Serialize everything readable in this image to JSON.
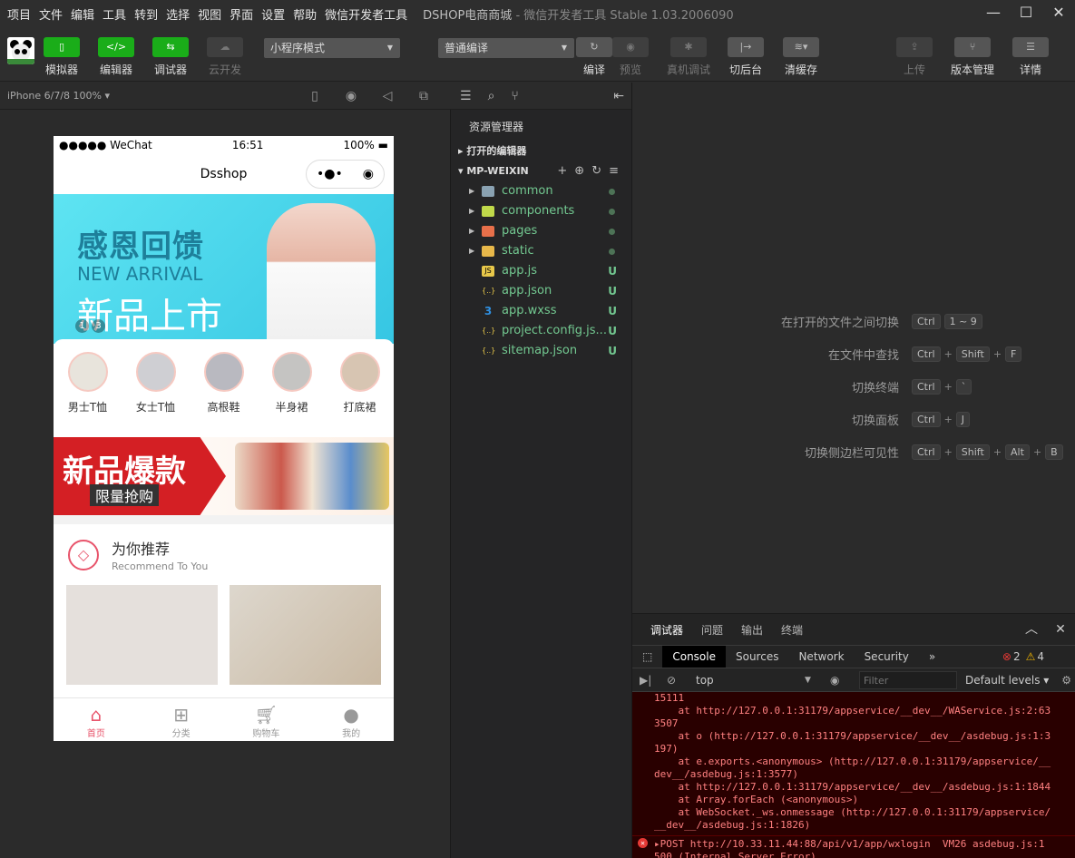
{
  "menu": [
    "项目",
    "文件",
    "编辑",
    "工具",
    "转到",
    "选择",
    "视图",
    "界面",
    "设置",
    "帮助",
    "微信开发者工具"
  ],
  "window": {
    "title": "DSHOP电商商城",
    "subtitle": "- 微信开发者工具 Stable 1.03.2006090"
  },
  "toolbar": {
    "simulator": "模拟器",
    "editor": "编辑器",
    "debugger": "调试器",
    "cloud": "云开发",
    "mode_select": "小程序模式",
    "compile_select": "普通编译",
    "compile": "编译",
    "preview": "预览",
    "remote_debug": "真机调试",
    "background": "切后台",
    "clear_cache": "清缓存",
    "upload": "上传",
    "version": "版本管理",
    "details": "详情"
  },
  "device": {
    "label": "iPhone 6/7/8 100% ▾"
  },
  "phone": {
    "carrier": "●●●●● WeChat",
    "time": "16:51",
    "battery": "100%",
    "nav_title": "Dsshop",
    "banner": {
      "line1": "感恩回馈",
      "line2": "NEW ARRIVAL",
      "line3": "新品上市",
      "page": "1",
      "total": "3"
    },
    "categories": [
      "男士T恤",
      "女士T恤",
      "高根鞋",
      "半身裙",
      "打底裙"
    ],
    "promo": {
      "title": "新品爆款",
      "subtitle": "限量抢购"
    },
    "recommend": {
      "title": "为你推荐",
      "subtitle": "Recommend To You"
    },
    "tabs": [
      "首页",
      "分类",
      "购物车",
      "我的"
    ]
  },
  "explorer": {
    "title": "资源管理器",
    "open_editors": "打开的编辑器",
    "project": "MP-WEIXIN",
    "items": [
      {
        "name": "common",
        "type": "folder",
        "color": "#8aa2b2",
        "status": ""
      },
      {
        "name": "components",
        "type": "folder",
        "color": "#c0d94a",
        "status": ""
      },
      {
        "name": "pages",
        "type": "folder",
        "color": "#e8704a",
        "status": ""
      },
      {
        "name": "static",
        "type": "folder",
        "color": "#e8b84a",
        "status": ""
      },
      {
        "name": "app.js",
        "type": "file",
        "icon": "JS",
        "color": "#e8c84a",
        "status": "U"
      },
      {
        "name": "app.json",
        "type": "file",
        "icon": "{..}",
        "color": "#e8c84a",
        "status": "U"
      },
      {
        "name": "app.wxss",
        "type": "file",
        "icon": "3",
        "color": "#2f8fe0",
        "status": "U"
      },
      {
        "name": "project.config.js...",
        "type": "file",
        "icon": "{..}",
        "color": "#e8c84a",
        "status": "U"
      },
      {
        "name": "sitemap.json",
        "type": "file",
        "icon": "{..}",
        "color": "#e8c84a",
        "status": "U"
      }
    ]
  },
  "shortcuts": [
    {
      "label": "在打开的文件之间切换",
      "keys": [
        "Ctrl",
        "1 ~ 9"
      ]
    },
    {
      "label": "在文件中查找",
      "keys": [
        "Ctrl",
        "Shift",
        "F"
      ]
    },
    {
      "label": "切换终端",
      "keys": [
        "Ctrl",
        "`"
      ]
    },
    {
      "label": "切换面板",
      "keys": [
        "Ctrl",
        "J"
      ]
    },
    {
      "label": "切换侧边栏可见性",
      "keys": [
        "Ctrl",
        "Shift",
        "Alt",
        "B"
      ]
    }
  ],
  "debug": {
    "tabs": [
      "调试器",
      "问题",
      "输出",
      "终端"
    ],
    "devtools_tabs": [
      "Console",
      "Sources",
      "Network",
      "Security"
    ],
    "errors": "2",
    "warnings": "4",
    "context": "top",
    "filter_placeholder": "Filter",
    "levels": "Default levels ▾",
    "log_lines": [
      "15111",
      "    at http://127.0.0.1:31179/appservice/__dev__/WAService.js:2:63",
      "3507",
      "    at o (http://127.0.0.1:31179/appservice/__dev__/asdebug.js:1:3",
      "197)",
      "    at e.exports.<anonymous> (http://127.0.0.1:31179/appservice/__",
      "dev__/asdebug.js:1:3577)",
      "    at http://127.0.0.1:31179/appservice/__dev__/asdebug.js:1:1844",
      "    at Array.forEach (<anonymous>)",
      "    at WebSocket._ws.onmessage (http://127.0.0.1:31179/appservice/",
      "__dev__/asdebug.js:1:1826)"
    ],
    "error_line1": "▸POST http://10.33.11.44:88/api/v1/app/wxlogin  VM26 asdebug.js:1",
    "error_line2": "500 (Internal Server Error)"
  }
}
